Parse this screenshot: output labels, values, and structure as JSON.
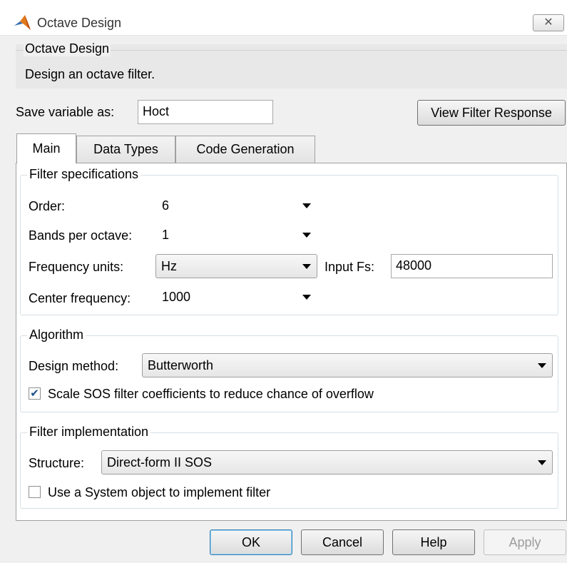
{
  "window": {
    "title": "Octave Design",
    "close_icon": "close-icon"
  },
  "header": {
    "title": "Octave Design",
    "description": "Design an octave filter."
  },
  "save_variable": {
    "label": "Save variable as:",
    "value": "Hoct"
  },
  "view_filter_response_label": "View Filter Response",
  "tabs": [
    {
      "label": "Main",
      "active": true
    },
    {
      "label": "Data Types",
      "active": false
    },
    {
      "label": "Code Generation",
      "active": false
    }
  ],
  "filter_specifications": {
    "title": "Filter specifications",
    "order": {
      "label": "Order:",
      "value": "6"
    },
    "bands_per_octave": {
      "label": "Bands per octave:",
      "value": "1"
    },
    "frequency_units": {
      "label": "Frequency units:",
      "value": "Hz"
    },
    "input_fs": {
      "label": "Input Fs:",
      "value": "48000"
    },
    "center_frequency": {
      "label": "Center frequency:",
      "value": "1000"
    }
  },
  "algorithm": {
    "title": "Algorithm",
    "design_method": {
      "label": "Design method:",
      "value": "Butterworth"
    },
    "scale_sos": {
      "label": "Scale SOS filter coefficients to reduce chance of overflow",
      "checked": true
    }
  },
  "filter_implementation": {
    "title": "Filter implementation",
    "structure": {
      "label": "Structure:",
      "value": "Direct-form II SOS"
    },
    "system_object": {
      "label": "Use a System object to implement filter",
      "checked": false
    }
  },
  "buttons": {
    "ok": "OK",
    "cancel": "Cancel",
    "help": "Help",
    "apply": "Apply"
  },
  "colors": {
    "accent": "#3c7fb1",
    "panel": "#ffffff",
    "background": "#f0f0f0"
  }
}
